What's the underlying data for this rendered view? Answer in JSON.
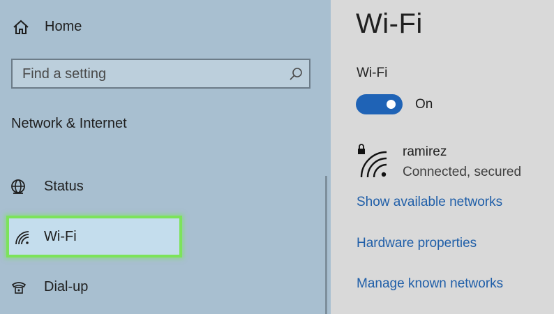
{
  "sidebar": {
    "home_label": "Home",
    "search": {
      "placeholder": "Find a setting"
    },
    "section_heading": "Network & Internet",
    "items": [
      {
        "label": "Status",
        "icon": "globe-icon"
      },
      {
        "label": "Wi-Fi",
        "icon": "wifi-icon",
        "selected": true
      },
      {
        "label": "Dial-up",
        "icon": "dialup-icon"
      }
    ]
  },
  "main": {
    "title": "Wi-Fi",
    "wifi_label": "Wi-Fi",
    "toggle": {
      "state_label": "On",
      "on": true
    },
    "network": {
      "name": "ramirez",
      "status": "Connected, secured",
      "icon": "secured-wifi-icon"
    },
    "links": [
      "Show available networks",
      "Hardware properties",
      "Manage known networks"
    ]
  },
  "colors": {
    "sidebar_bg": "#a8bfd0",
    "content_bg": "#d9d9d9",
    "accent": "#1f63b6",
    "link": "#1f5ea8",
    "highlight_border": "#7ce35a"
  }
}
